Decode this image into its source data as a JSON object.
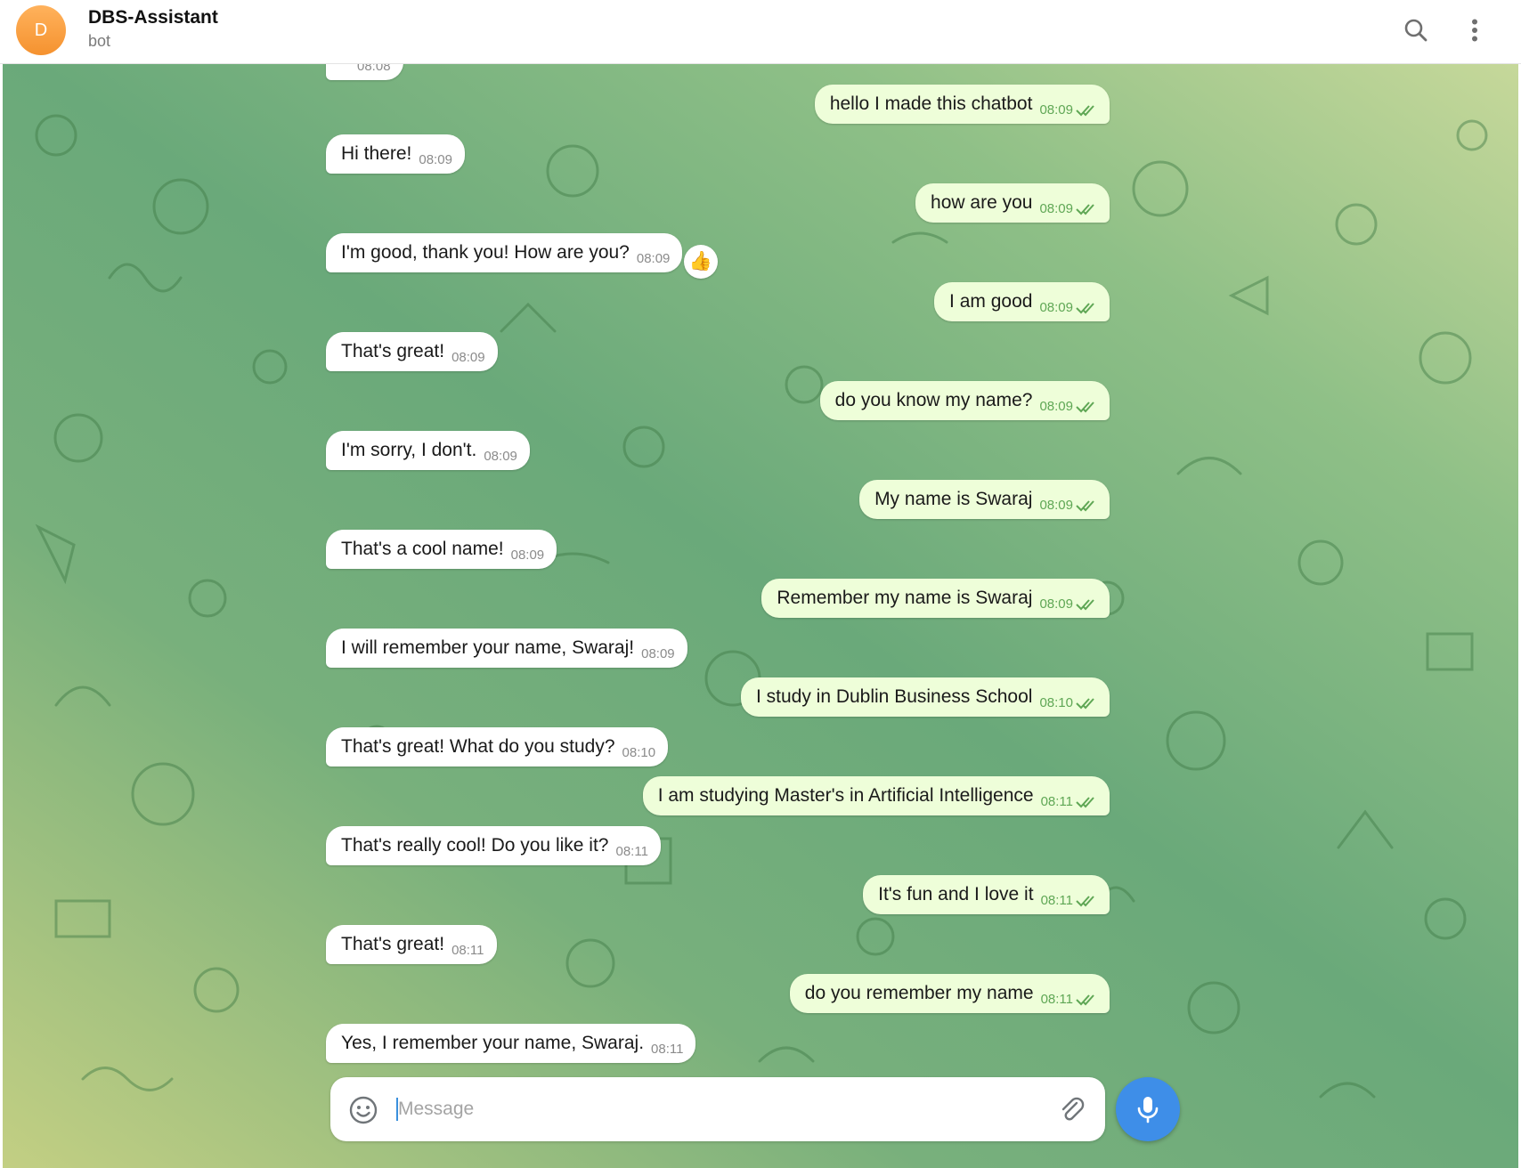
{
  "header": {
    "avatar_letter": "D",
    "title": "DBS-Assistant",
    "subtitle": "bot",
    "icons": [
      "search-icon",
      "more-vertical-icon"
    ]
  },
  "messages": [
    {
      "dir": "in",
      "text": "",
      "time": "08:08"
    },
    {
      "dir": "out",
      "text": "hello I made this chatbot",
      "time": "08:09"
    },
    {
      "dir": "in",
      "text": "Hi there!",
      "time": "08:09"
    },
    {
      "dir": "out",
      "text": "how are you",
      "time": "08:09"
    },
    {
      "dir": "in",
      "text": "I'm good, thank you! How are you?",
      "time": "08:09",
      "reaction": "👍"
    },
    {
      "dir": "out",
      "text": "I am good",
      "time": "08:09"
    },
    {
      "dir": "in",
      "text": "That's great!",
      "time": "08:09"
    },
    {
      "dir": "out",
      "text": "do you know my name?",
      "time": "08:09"
    },
    {
      "dir": "in",
      "text": "I'm sorry, I don't.",
      "time": "08:09"
    },
    {
      "dir": "out",
      "text": "My name is Swaraj",
      "time": "08:09"
    },
    {
      "dir": "in",
      "text": "That's a cool name!",
      "time": "08:09"
    },
    {
      "dir": "out",
      "text": "Remember my name is Swaraj",
      "time": "08:09"
    },
    {
      "dir": "in",
      "text": "I will remember your name, Swaraj!",
      "time": "08:09"
    },
    {
      "dir": "out",
      "text": "I study in Dublin Business School",
      "time": "08:10"
    },
    {
      "dir": "in",
      "text": "That's great! What do you study?",
      "time": "08:10"
    },
    {
      "dir": "out",
      "text": "I am studying Master's in Artificial Intelligence",
      "time": "08:11"
    },
    {
      "dir": "in",
      "text": "That's really cool! Do you like it?",
      "time": "08:11"
    },
    {
      "dir": "out",
      "text": "It's fun and I love it",
      "time": "08:11"
    },
    {
      "dir": "in",
      "text": "That's great!",
      "time": "08:11"
    },
    {
      "dir": "out",
      "text": "do you remember my name",
      "time": "08:11"
    },
    {
      "dir": "in",
      "text": "Yes, I remember your name, Swaraj.",
      "time": "08:11"
    }
  ],
  "composer": {
    "placeholder": "Message",
    "icons": [
      "emoji-icon",
      "paperclip-icon",
      "microphone-icon"
    ]
  },
  "colors": {
    "outgoing_bubble": "#eefed9",
    "incoming_bubble": "#ffffff",
    "check_color": "#5fa755",
    "mic_button": "#3e8ee8",
    "avatar": "#f5922f"
  }
}
